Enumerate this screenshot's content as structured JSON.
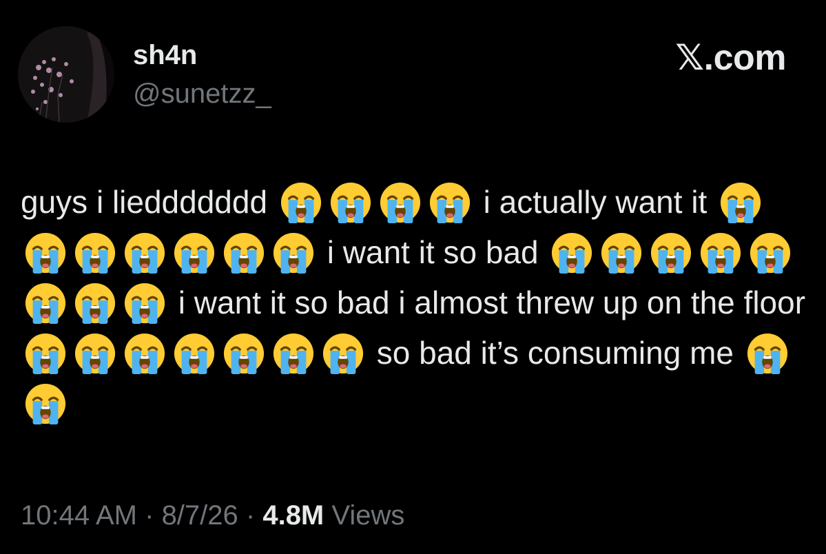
{
  "author": {
    "display_name": "sh4n",
    "handle": "@sunetzz_"
  },
  "brand": {
    "logo_glyph": "𝕏",
    "domain_suffix": ".com"
  },
  "tweet": {
    "segments": [
      {
        "type": "text",
        "value": "guys i lieddddddd "
      },
      {
        "type": "emoji",
        "count": 4,
        "icon": "loudly-crying-face-icon"
      },
      {
        "type": "text",
        "value": " i actually want it "
      },
      {
        "type": "emoji",
        "count": 7,
        "icon": "loudly-crying-face-icon"
      },
      {
        "type": "text",
        "value": " i want it so bad "
      },
      {
        "type": "emoji",
        "count": 8,
        "icon": "loudly-crying-face-icon"
      },
      {
        "type": "text",
        "value": " i want it so bad i almost threw up on the floor "
      },
      {
        "type": "emoji",
        "count": 7,
        "icon": "loudly-crying-face-icon"
      },
      {
        "type": "text",
        "value": " so bad it’s consuming me "
      },
      {
        "type": "emoji",
        "count": 2,
        "icon": "loudly-crying-face-icon"
      }
    ]
  },
  "meta": {
    "time": "10:44 AM",
    "separator": " · ",
    "date": "8/7/26",
    "views_count": "4.8M",
    "views_label": " Views"
  },
  "colors": {
    "background": "#000000",
    "primary_text": "#e7e9ea",
    "secondary_text": "#71767b",
    "emoji_face": "#ffcc33",
    "emoji_tears": "#4fb3f0"
  }
}
